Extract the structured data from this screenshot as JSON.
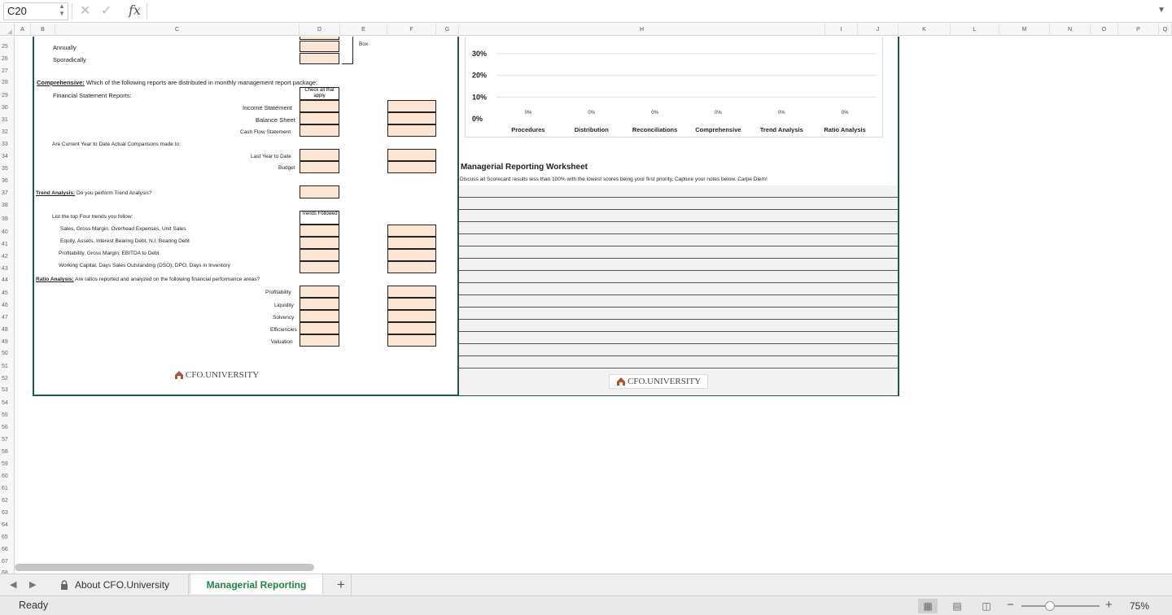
{
  "formula_bar": {
    "name_box": "C20",
    "cancel_icon": "x-icon",
    "confirm_icon": "check-icon",
    "fx_label": "fx",
    "formula": ""
  },
  "columns": [
    "A",
    "B",
    "C",
    "D",
    "E",
    "F",
    "G",
    "H",
    "I",
    "J",
    "K",
    "L",
    "M",
    "N",
    "O",
    "P",
    "Q"
  ],
  "rows": [
    "25",
    "26",
    "27",
    "28",
    "29",
    "30",
    "31",
    "32",
    "33",
    "34",
    "35",
    "36",
    "37",
    "38",
    "39",
    "40",
    "41",
    "42",
    "43",
    "44",
    "45",
    "46",
    "47",
    "48",
    "49",
    "50",
    "51",
    "52",
    "53",
    "54",
    "55",
    "56",
    "57",
    "58",
    "59",
    "60",
    "61",
    "62",
    "63",
    "64",
    "65",
    "66",
    "67",
    "68"
  ],
  "left_panel": {
    "box_fragment": "Box",
    "annually": "Annually",
    "sporadically": "Sporadically",
    "comprehensive_label": "Comprehensive:",
    "comprehensive_q": " Which of the following reports are distributed  in monthly management report package:",
    "check_all": "Check all that apply",
    "fin_reports": "Financial Statement Reports:",
    "income": "Income Statement",
    "balance": "Balance Sheet",
    "cashflow": "Cash Flow Statement",
    "ytd_q": "Are Current Year to Date  Actual Comparisons made  to:",
    "last_year": "Last Year to Date",
    "budget": "Budget",
    "trend_label": "Trend Analysis:",
    "trend_q": " Do you perform Trend Analysis?",
    "list_trends": "List the top Four trends you follow:",
    "trends_followed": "Trends Followed",
    "trend_1": "Sales, Gross Margin, Overhead Expenses, Unit Sales",
    "trend_2": "Equity, Assets,  Interest Bearing Debt, N.I. Bearing Debt",
    "trend_3": "Profitability, Gross Margin,  EBITDA to Debt",
    "trend_4": "Working Capital, Days Sales Outstanding (DSO),  DPO,  Days in Inventory",
    "ratio_label": "Ratio Analysis:",
    "ratio_q": " Are ratios reported and analyzed on the following financial performance areas?",
    "profitability": "Profitability",
    "liquidity": "Liquidity",
    "solvency": "Solvency",
    "efficiencies": "Efficiencies",
    "valuation": "Valuation",
    "logo_text": "CFO.UNIVERSITY"
  },
  "chart_data": {
    "type": "bar",
    "categories": [
      "Procedures",
      "Distribution",
      "Reconciliations",
      "Comprehensive",
      "Trend Analysis",
      "Ratio Analysis"
    ],
    "values": [
      0,
      0,
      0,
      0,
      0,
      0
    ],
    "data_labels": [
      "0%",
      "0%",
      "0%",
      "0%",
      "0%",
      "0%"
    ],
    "yticks": [
      "30%",
      "20%",
      "10%",
      "0%"
    ],
    "ylim_visible": [
      0,
      30
    ],
    "title": "",
    "grid": true
  },
  "worksheet": {
    "title": "Managerial Reporting Worksheet",
    "instructions": "Discuss all Scorecard results less than 100% with the lowest scores being your first priority.  Capture your notes below. Carpe Diem!",
    "logo_text": "CFO.UNIVERSITY"
  },
  "tabs": {
    "prev_icon": "triangle-left-icon",
    "next_icon": "triangle-right-icon",
    "about": "About CFO.University",
    "managerial": "Managerial Reporting",
    "add": "+"
  },
  "status": {
    "ready": "Ready",
    "zoom": "75%",
    "zoom_minus": "−",
    "zoom_plus": "+"
  },
  "colors": {
    "panel_border": "#1f5c3f",
    "input_fill": "#fbe5d3",
    "active_tab": "#1e8449"
  }
}
